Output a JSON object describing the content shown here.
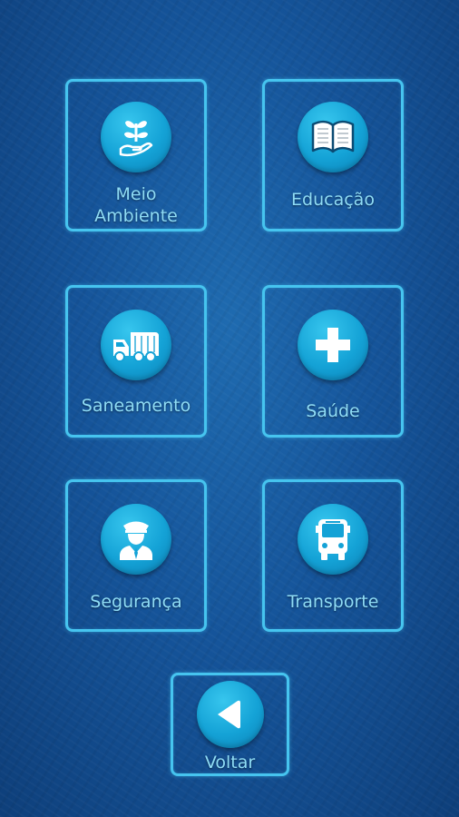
{
  "menu": {
    "items": [
      {
        "label_line1": "Meio",
        "label_line2": "Ambiente",
        "icon": "plant-hand-icon"
      },
      {
        "label": "Educação",
        "icon": "book-icon"
      },
      {
        "label": "Saneamento",
        "icon": "garbage-truck-icon"
      },
      {
        "label": "Saúde",
        "icon": "medical-cross-icon"
      },
      {
        "label": "Segurança",
        "icon": "police-officer-icon"
      },
      {
        "label": "Transporte",
        "icon": "bus-icon"
      }
    ],
    "back": {
      "label": "Voltar",
      "icon": "back-arrow-icon"
    }
  },
  "colors": {
    "background": "#15549a",
    "tile_border": "#46c4ef",
    "icon_circle": "#14a2d6",
    "label_text": "#8fdcf5"
  }
}
